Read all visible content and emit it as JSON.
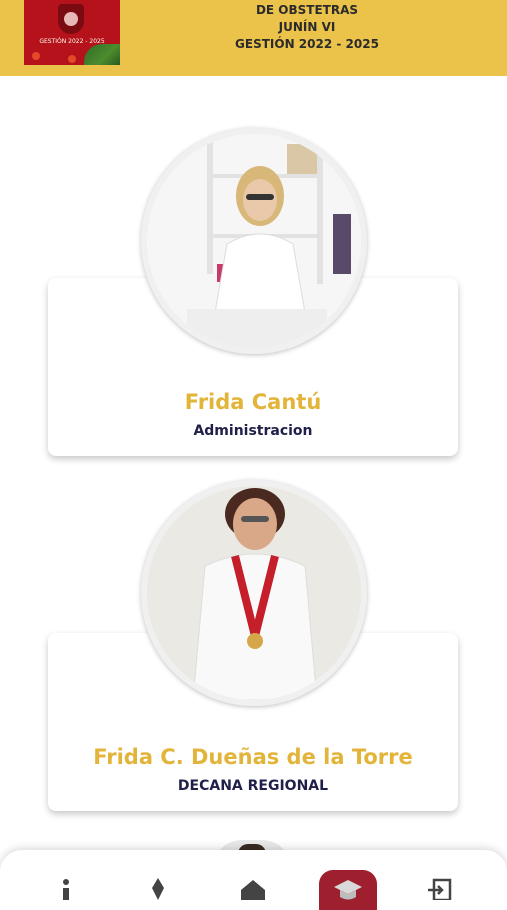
{
  "header": {
    "logo_text": "GESTIÓN 2022 - 2025",
    "title_line1": "DE OBSTETRAS",
    "title_line2": "JUNÍN VI",
    "title_line3": "GESTIÓN 2022 - 2025"
  },
  "members": [
    {
      "name": "Frida Cantú",
      "role": "Administracion"
    },
    {
      "name": "Frida C. Dueñas de la Torre",
      "role": "DECANA REGIONAL"
    }
  ],
  "bottom_nav": {
    "items": [
      {
        "icon": "info-icon"
      },
      {
        "icon": "drop-icon"
      },
      {
        "icon": "home-icon"
      },
      {
        "icon": "graduation-cap-icon",
        "active": true
      },
      {
        "icon": "logout-icon"
      }
    ],
    "active_color": "#9E1F2E"
  },
  "colors": {
    "header_bg": "#EBC24A",
    "name_gold": "#E3B43A",
    "role_navy": "#1f1f4a"
  }
}
